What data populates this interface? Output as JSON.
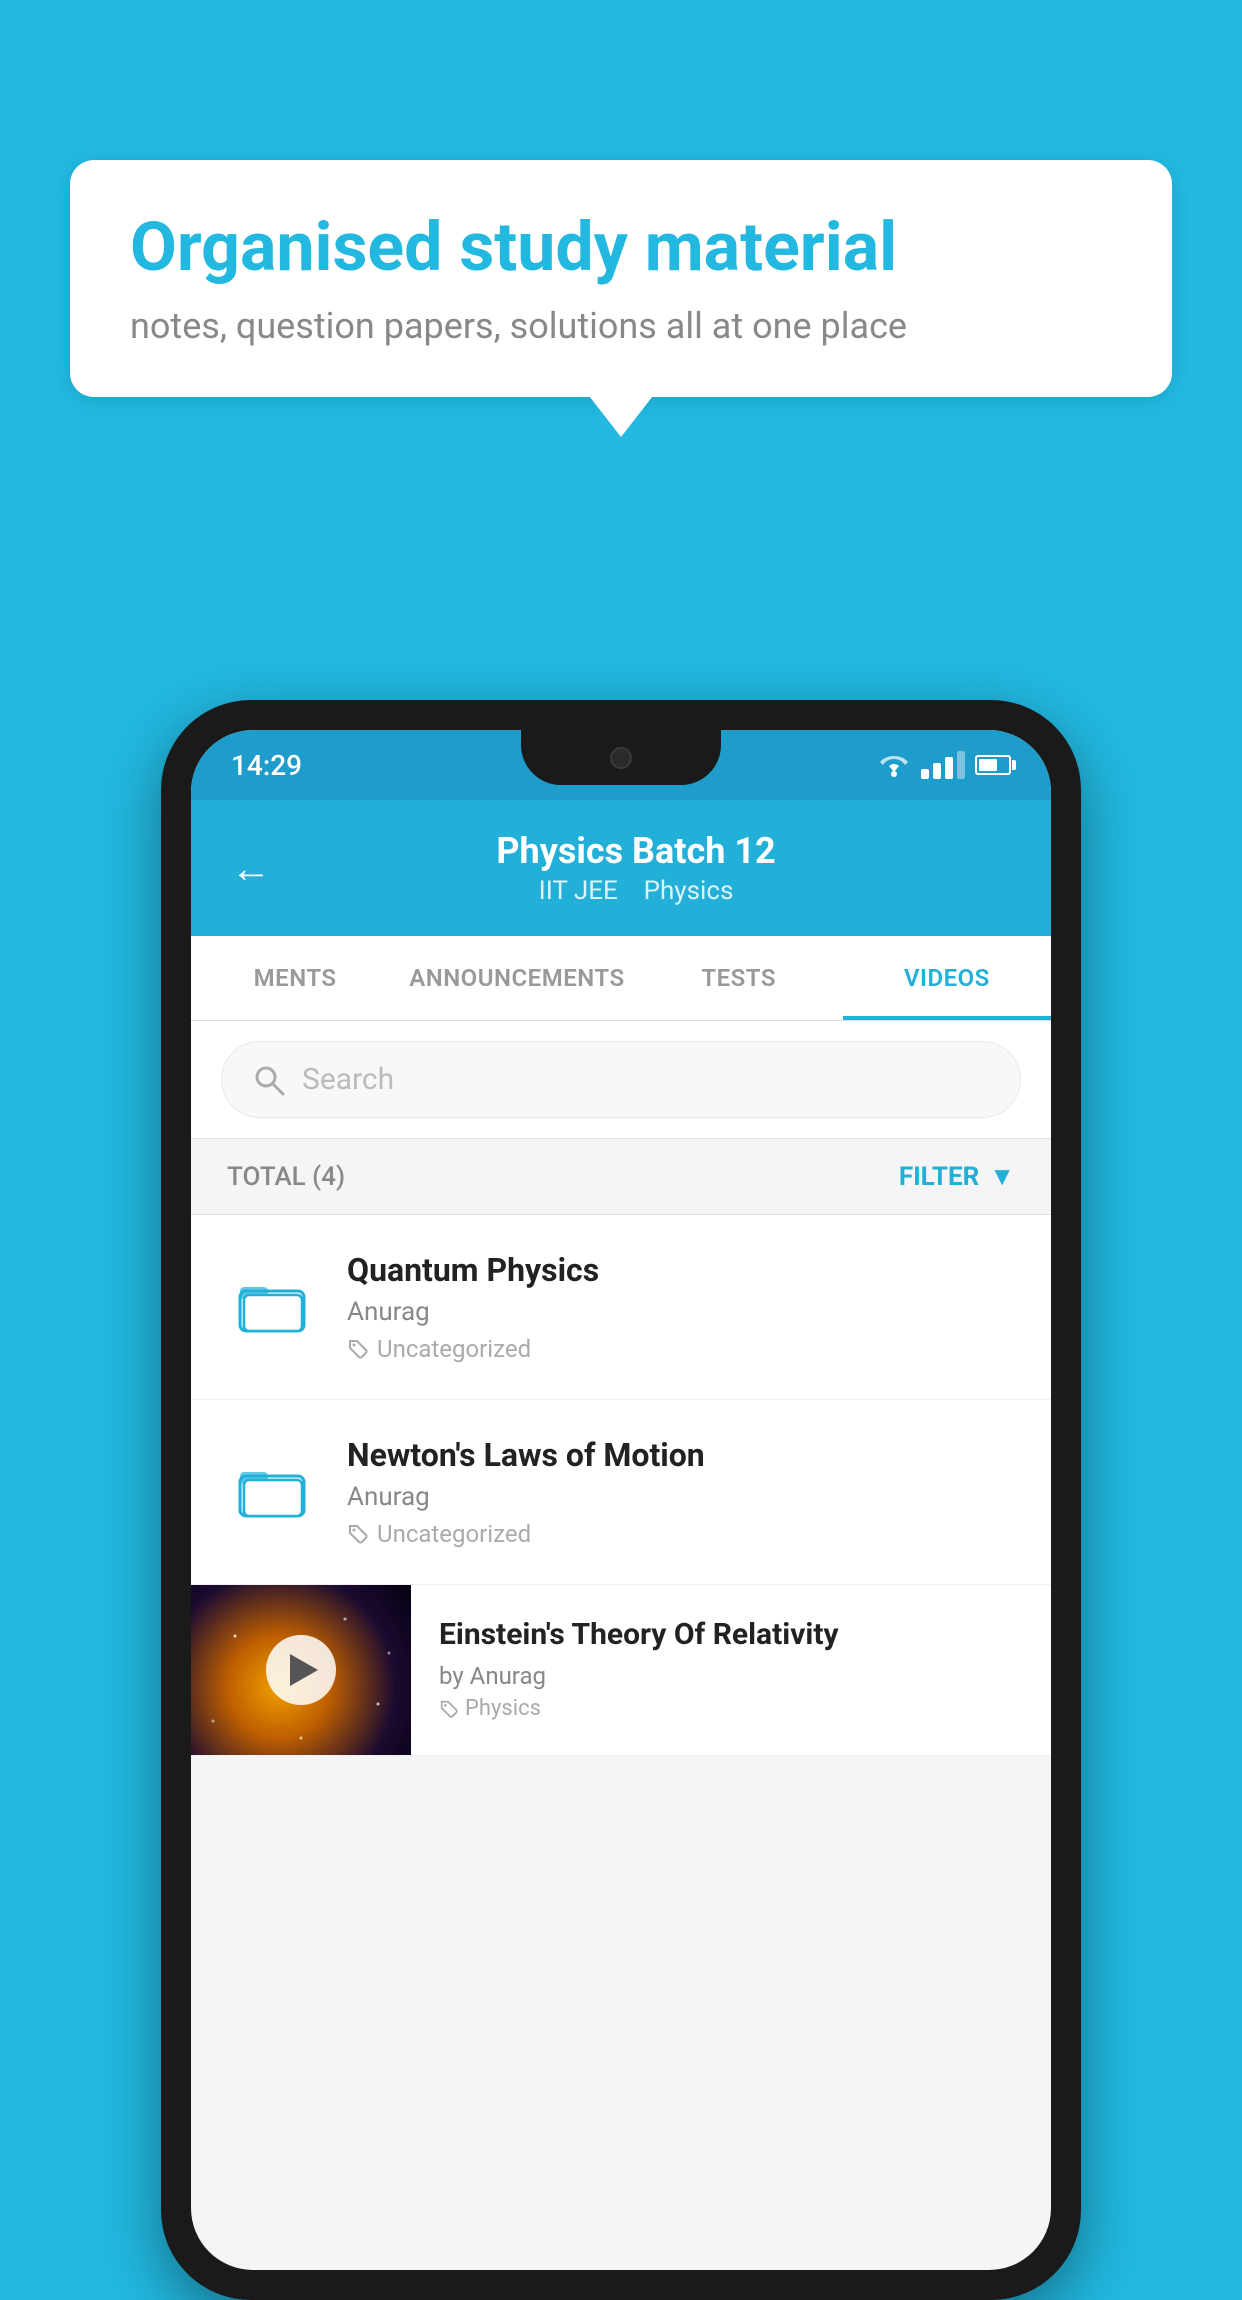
{
  "background": {
    "color": "#22b8e0"
  },
  "speech_bubble": {
    "title": "Organised study material",
    "subtitle": "notes, question papers, solutions all at one place"
  },
  "phone": {
    "status_bar": {
      "time": "14:29"
    },
    "header": {
      "title": "Physics Batch 12",
      "subtitle_part1": "IIT JEE",
      "subtitle_part2": "Physics",
      "back_label": "←"
    },
    "tabs": [
      {
        "label": "MENTS",
        "active": false
      },
      {
        "label": "ANNOUNCEMENTS",
        "active": false
      },
      {
        "label": "TESTS",
        "active": false
      },
      {
        "label": "VIDEOS",
        "active": true
      }
    ],
    "search": {
      "placeholder": "Search"
    },
    "filter_bar": {
      "total_label": "TOTAL (4)",
      "filter_label": "FILTER"
    },
    "videos": [
      {
        "id": "quantum-physics",
        "title": "Quantum Physics",
        "author": "Anurag",
        "tag": "Uncategorized",
        "has_thumbnail": false
      },
      {
        "id": "newtons-laws",
        "title": "Newton's Laws of Motion",
        "author": "Anurag",
        "tag": "Uncategorized",
        "has_thumbnail": false
      },
      {
        "id": "einsteins-theory",
        "title": "Einstein's Theory Of Relativity",
        "author": "by Anurag",
        "tag": "Physics",
        "has_thumbnail": true
      }
    ]
  }
}
